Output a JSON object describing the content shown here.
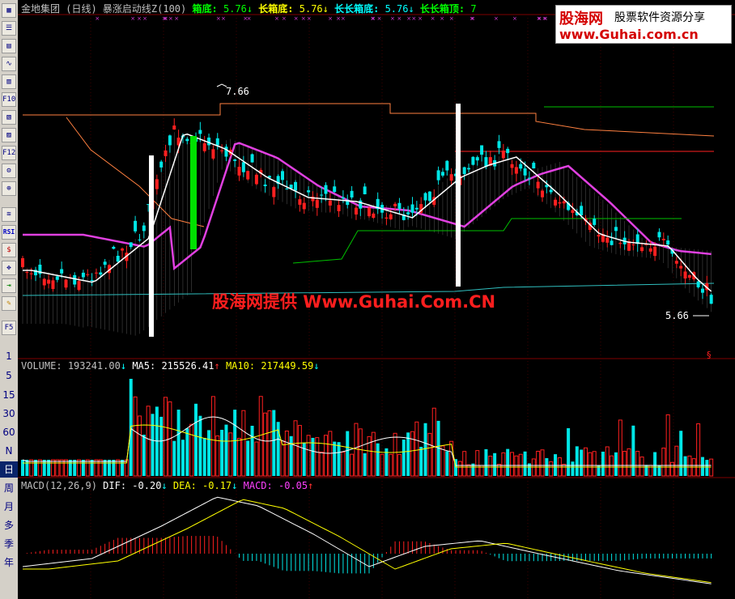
{
  "header": {
    "title": "金地集团 (日线) 暴涨启动线Z(100)",
    "items": [
      {
        "label": "箱底:",
        "value": "5.76",
        "arrow": "↓",
        "label_color": "#00ff00",
        "value_color": "#00ff00"
      },
      {
        "label": "长箱底:",
        "value": "5.76",
        "arrow": "↓",
        "label_color": "#ffff00",
        "value_color": "#ffff00"
      },
      {
        "label": "长长箱底:",
        "value": "5.76",
        "arrow": "↓",
        "label_color": "#00ffff",
        "value_color": "#00ffff"
      },
      {
        "label": "长长箱顶:",
        "value": "7",
        "arrow": "",
        "label_color": "#00ff00",
        "value_color": "#00ff00"
      }
    ]
  },
  "logo": {
    "brand": "股海网",
    "slogan": "股票软件资源分享",
    "url": "www.Guhai.com.cn"
  },
  "watermark": "股海网提供 Www.Guhai.Com.CN",
  "price_labels": {
    "high": "7.66",
    "low": "5.66"
  },
  "volume_header": {
    "name": "VOLUME:",
    "value": "193241.00",
    "value_arrow": "↓",
    "ma5_label": "MA5:",
    "ma5_value": "215526.41",
    "ma5_arrow": "↑",
    "ma10_label": "MA10:",
    "ma10_value": "217449.59",
    "ma10_arrow": "↓"
  },
  "macd_header": {
    "name": "MACD(12,26,9)",
    "dif_label": "DIF:",
    "dif_value": "-0.20",
    "dif_arrow": "↓",
    "dea_label": "DEA:",
    "dea_value": "-0.17",
    "dea_arrow": "↓",
    "macd_label": "MACD:",
    "macd_value": "-0.05",
    "macd_arrow": "↑"
  },
  "sidebar": {
    "icon_buttons": [
      "grid-icon",
      "list-icon",
      "table-icon",
      "line-chart-icon",
      "candle-icon",
      "grid2-icon",
      "F10-icon",
      "report-icon",
      "info-icon",
      "F12-icon",
      "tools-icon",
      "zoom-icon"
    ],
    "labels": {
      "f10": "F10",
      "f12": "F12",
      "rsi": "RSI",
      "f5": "F5"
    },
    "periods": [
      "1",
      "5",
      "15",
      "30",
      "60",
      "N",
      "日",
      "周",
      "月",
      "多",
      "季",
      "年"
    ],
    "active_period": "日"
  },
  "colors": {
    "up": "#ff2020",
    "down": "#00e6e6",
    "magenta_line": "#e040e0",
    "background": "#000000",
    "grid": "#800000"
  }
}
